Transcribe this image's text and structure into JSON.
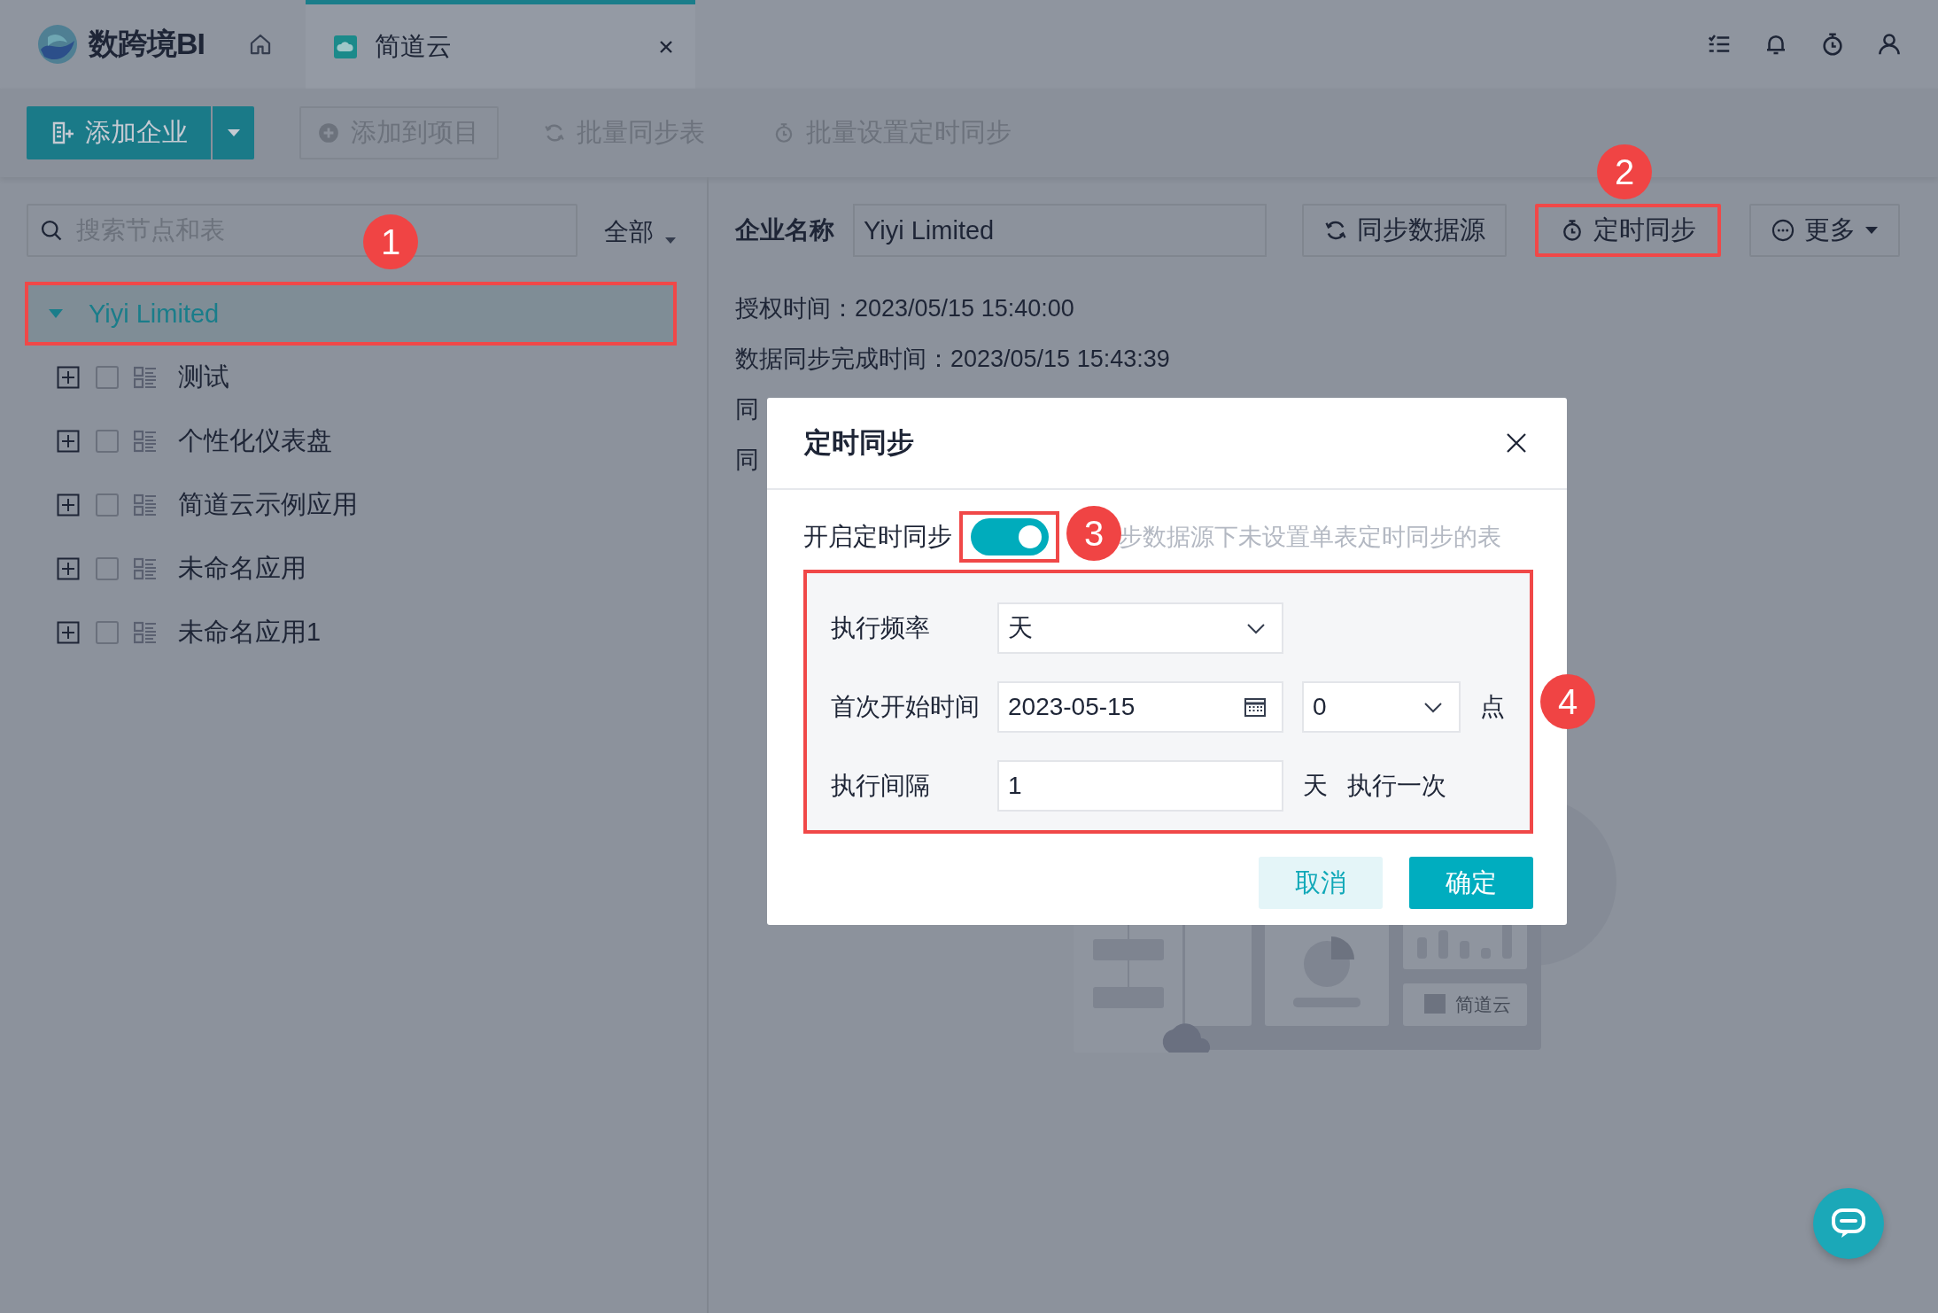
{
  "app": {
    "logo_text": "数跨境BI"
  },
  "tabs": [
    {
      "label": "简道云",
      "selected": true,
      "closable": true
    }
  ],
  "toolbar": {
    "primary": "添加企业",
    "buttons": [
      {
        "label": "添加到项目",
        "kind": "bordered"
      },
      {
        "label": "批量同步表",
        "kind": "plain"
      },
      {
        "label": "批量设置定时同步",
        "kind": "plain"
      }
    ]
  },
  "sidebar": {
    "search": {
      "placeholder": "搜索节点和表"
    },
    "filter": "全部",
    "tree": {
      "label": "Yiyi Limited",
      "expanded": true,
      "selected": true,
      "badge": "1",
      "children": [
        {
          "label": "测试",
          "checked": false,
          "expanded": false
        },
        {
          "label": "个性化仪表盘",
          "checked": false,
          "expanded": false
        },
        {
          "label": "简道云示例应用",
          "checked": false,
          "expanded": false
        },
        {
          "label": "未命名应用",
          "checked": false,
          "expanded": false
        },
        {
          "label": "未命名应用1",
          "checked": false,
          "expanded": false
        }
      ]
    }
  },
  "detail": {
    "name_label": "企业名称",
    "name_value": "Yiyi Limited",
    "actions": [
      {
        "label": "同步数据源",
        "kind": "button"
      },
      {
        "label": "定时同步",
        "kind": "button",
        "badge": "2"
      },
      {
        "label": "更多",
        "kind": "menu"
      }
    ],
    "info": [
      "授权时间：2023/05/15 15:40:00",
      "数据同步完成时间：2023/05/15 15:43:39",
      "同",
      "同"
    ],
    "illustration": {
      "label": "简道云"
    }
  },
  "dialog": {
    "title": "定时同步",
    "toggle": {
      "label": "开启定时同步",
      "on": true,
      "badge": "3",
      "hint": "步数据源下未设置单表定时同步的表"
    },
    "form": {
      "badge": "4",
      "rows": [
        {
          "label": "执行频率",
          "fields": [
            {
              "kind": "select",
              "value": "天"
            }
          ]
        },
        {
          "label": "首次开始时间",
          "fields": [
            {
              "kind": "date",
              "value": "2023-05-15"
            },
            {
              "kind": "hour",
              "value": "0"
            },
            {
              "kind": "unit",
              "value": "点"
            }
          ]
        },
        {
          "label": "执行间隔",
          "fields": [
            {
              "kind": "input",
              "value": "1"
            },
            {
              "kind": "unit",
              "value": "天"
            },
            {
              "kind": "unit",
              "value": "执行一次"
            }
          ]
        }
      ]
    },
    "buttons": [
      {
        "label": "取消",
        "kind": "secondary"
      },
      {
        "label": "确定",
        "kind": "primary"
      }
    ]
  }
}
